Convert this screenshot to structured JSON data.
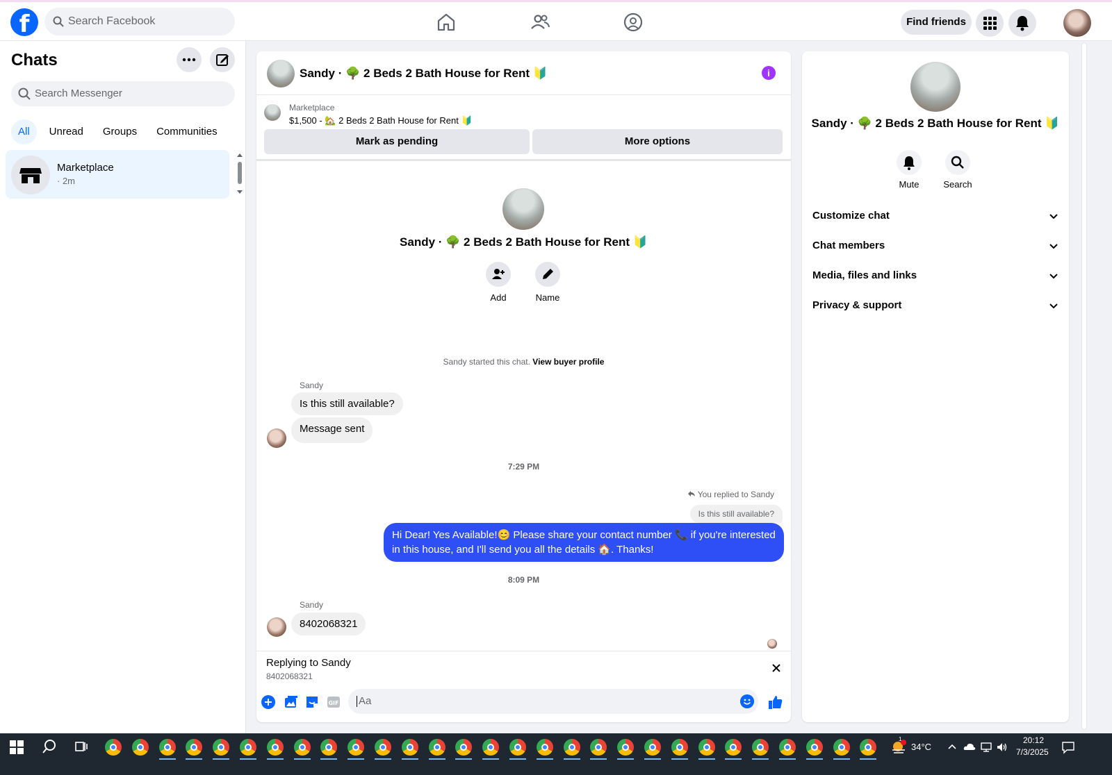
{
  "topbar": {
    "logo": "f",
    "search_placeholder": "Search Facebook",
    "nav_icons": [
      "home-icon",
      "friends-icon",
      "groups-icon"
    ],
    "find_friends_label": "Find friends"
  },
  "sidebar": {
    "title": "Chats",
    "search_placeholder": "Search Messenger",
    "filters": [
      "All",
      "Unread",
      "Groups",
      "Communities"
    ],
    "active_filter": "All",
    "chats": [
      {
        "name": "Marketplace",
        "time": "· 2m"
      }
    ]
  },
  "conversation": {
    "title": "Sandy · 🌳 2 Beds 2 Bath House for Rent 🔰",
    "marketplace_label": "Marketplace",
    "listing": "$1,500 - 🏡 2 Beds 2 Bath House for Rent 🔰",
    "mark_pending_label": "Mark as pending",
    "more_options_label": "More options",
    "add_label": "Add",
    "name_label": "Name",
    "started_text": "Sandy started this chat.",
    "view_buyer_label": "View buyer profile",
    "messages": [
      {
        "sender": "Sandy",
        "text": "Is this still available?"
      },
      {
        "text": "Message sent"
      }
    ],
    "time_1": "7:29 PM",
    "replied_label": "You replied to Sandy",
    "reply_quote": "Is this still available?",
    "outgoing_text": "Hi Dear! Yes Available!😊 Please share your contact number 📞 if you're interested in this house, and I'll send you all the details 🏠. Thanks!",
    "time_2": "8:09 PM",
    "last_sender": "Sandy",
    "last_message": "8402068321",
    "replying_title": "Replying to Sandy",
    "replying_sub": "8402068321",
    "composer_placeholder": "Aa",
    "accent_color": "#2e4ff5"
  },
  "info_panel": {
    "title": "Sandy · 🌳 2 Beds 2 Bath House for Rent 🔰",
    "mute_label": "Mute",
    "search_label": "Search",
    "sections": [
      "Customize chat",
      "Chat members",
      "Media, files and links",
      "Privacy & support"
    ]
  },
  "taskbar": {
    "temperature": "34°C",
    "time": "20:12",
    "date": "7/3/2025",
    "weather_badge": "1"
  }
}
